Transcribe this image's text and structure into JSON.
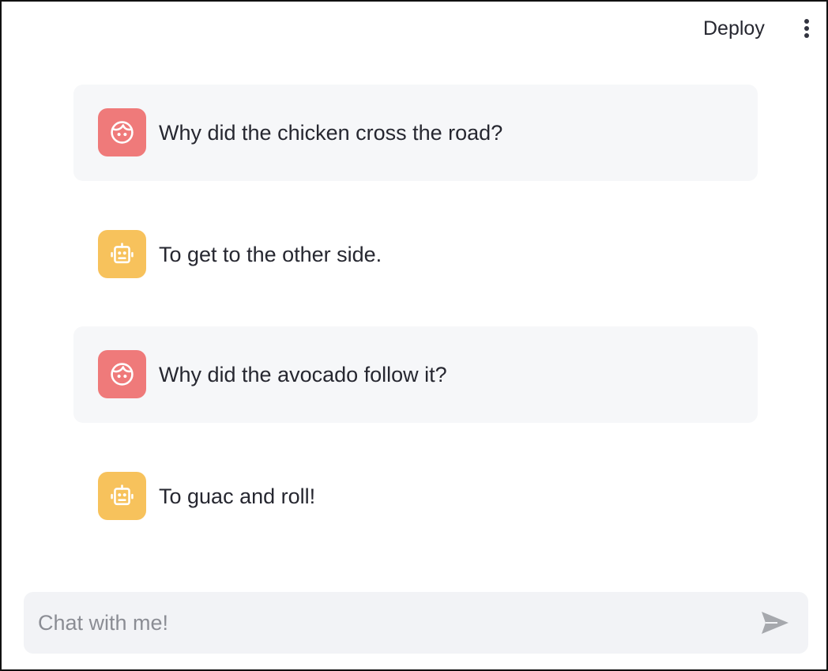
{
  "header": {
    "deploy_label": "Deploy",
    "menu_icon": "vertical-ellipsis-icon"
  },
  "messages": [
    {
      "role": "user",
      "avatar_icon": "face-icon",
      "text": "Why did the chicken cross the road?"
    },
    {
      "role": "assistant",
      "avatar_icon": "robot-icon",
      "text": "To get to the other side."
    },
    {
      "role": "user",
      "avatar_icon": "face-icon",
      "text": "Why did the avocado follow it?"
    },
    {
      "role": "assistant",
      "avatar_icon": "robot-icon",
      "text": "To guac and roll!"
    }
  ],
  "chat_input": {
    "placeholder": "Chat with me!",
    "value": "",
    "send_icon": "send-icon"
  },
  "colors": {
    "user_avatar": "#ef7a7a",
    "assistant_avatar": "#f7c25c",
    "user_message_bg": "#f6f7f9",
    "input_bg": "#f2f3f6"
  }
}
